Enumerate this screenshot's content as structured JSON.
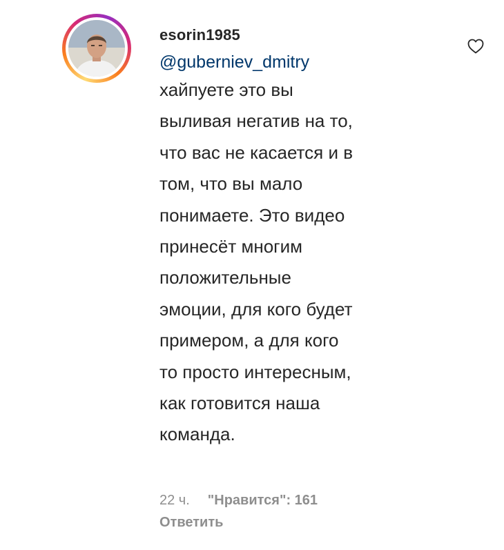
{
  "comment": {
    "username": "esorin1985",
    "mention": "@guberniev_dmitry",
    "text": "хайпуете это вы\nвыливая негатив на то,\nчто вас не касается и в\nтом, что вы мало\nпонимаете. Это видео\nпринесёт многим\nположительные\nэмоции, для кого будет\nпримером, а для кого\nто просто интересным,\nкак готовится наша\nкоманда.",
    "time": "22 ч.",
    "likes": "\"Нравится\": 161",
    "reply_label": "Ответить",
    "icons": {
      "like": "heart-outline-icon",
      "avatar": "profile-photo"
    },
    "colors": {
      "text": "#262626",
      "mention": "#00376b",
      "meta": "#8e8e8e",
      "ring": [
        "#feda75",
        "#fa7e1e",
        "#d62976",
        "#962fbf"
      ]
    }
  }
}
